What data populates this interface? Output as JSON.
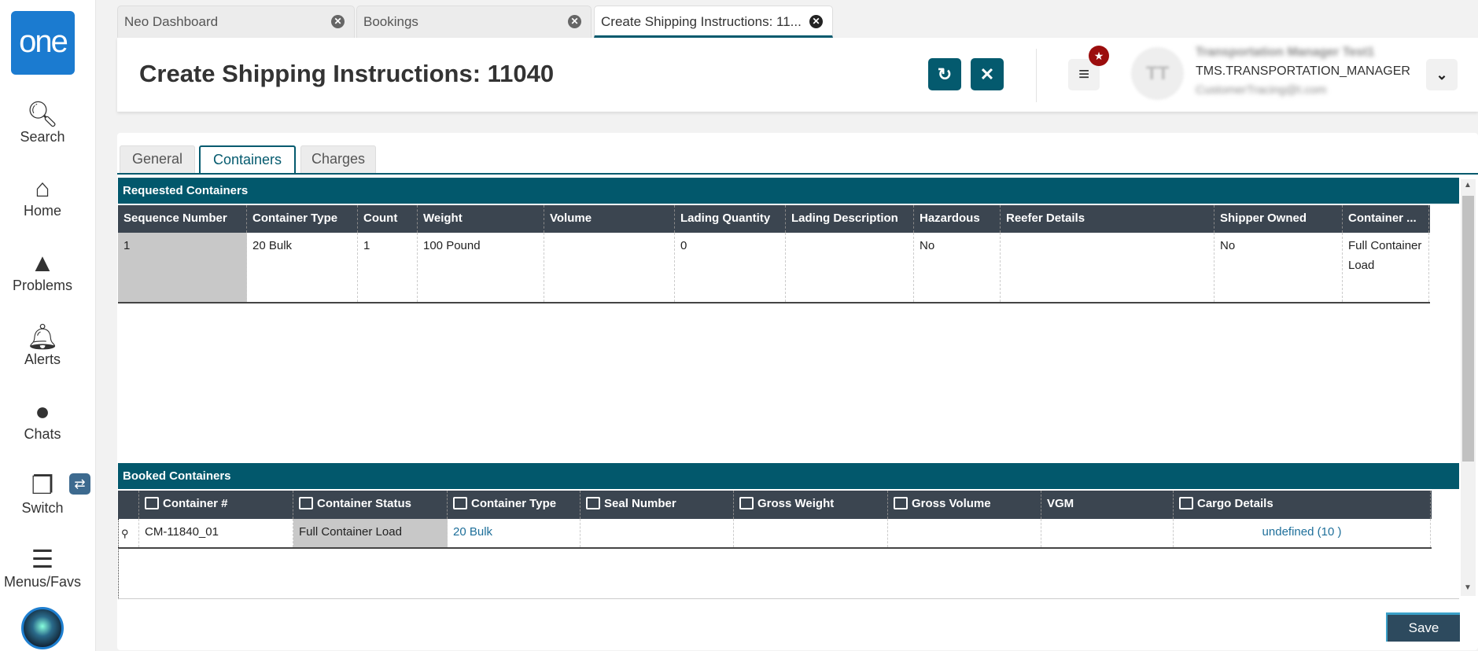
{
  "sidebar": {
    "logo": "one",
    "items": [
      {
        "label": "Search"
      },
      {
        "label": "Home"
      },
      {
        "label": "Problems"
      },
      {
        "label": "Alerts"
      },
      {
        "label": "Chats"
      },
      {
        "label": "Switch"
      },
      {
        "label": "Menus/Favs"
      }
    ]
  },
  "tabs": [
    {
      "label": "Neo Dashboard"
    },
    {
      "label": "Bookings"
    },
    {
      "label": "Create Shipping Instructions: 11..."
    }
  ],
  "header": {
    "title": "Create Shipping Instructions: 11040",
    "user_initials": "TT",
    "user_name": "Transportation Manager Test1",
    "user_role": "TMS.TRANSPORTATION_MANAGER",
    "user_email": "CustomerTracing@t.com"
  },
  "subtabs": [
    {
      "label": "General"
    },
    {
      "label": "Containers"
    },
    {
      "label": "Charges"
    }
  ],
  "requested": {
    "title": "Requested Containers",
    "columns": [
      "Sequence Number",
      "Container Type",
      "Count",
      "Weight",
      "Volume",
      "Lading Quantity",
      "Lading Description",
      "Hazardous",
      "Reefer Details",
      "Shipper Owned",
      "Container ..."
    ],
    "rows": [
      [
        "1",
        "20 Bulk",
        "1",
        "100 Pound",
        "",
        "0",
        "",
        "No",
        "",
        "No",
        "Full Container Load"
      ]
    ]
  },
  "booked": {
    "title": "Booked Containers",
    "columns": [
      "Container #",
      "Container Status",
      "Container Type",
      "Seal Number",
      "Gross Weight",
      "Gross Volume",
      "VGM",
      "Cargo Details"
    ],
    "rows": [
      [
        "CM-11840_01",
        "Full Container Load",
        "20 Bulk",
        "",
        "",
        "",
        "",
        "undefined (10 )"
      ]
    ]
  },
  "save_label": "Save",
  "colors": {
    "accent": "#045a6e",
    "header_row": "#3b4550",
    "badge": "#9b0d0d"
  }
}
